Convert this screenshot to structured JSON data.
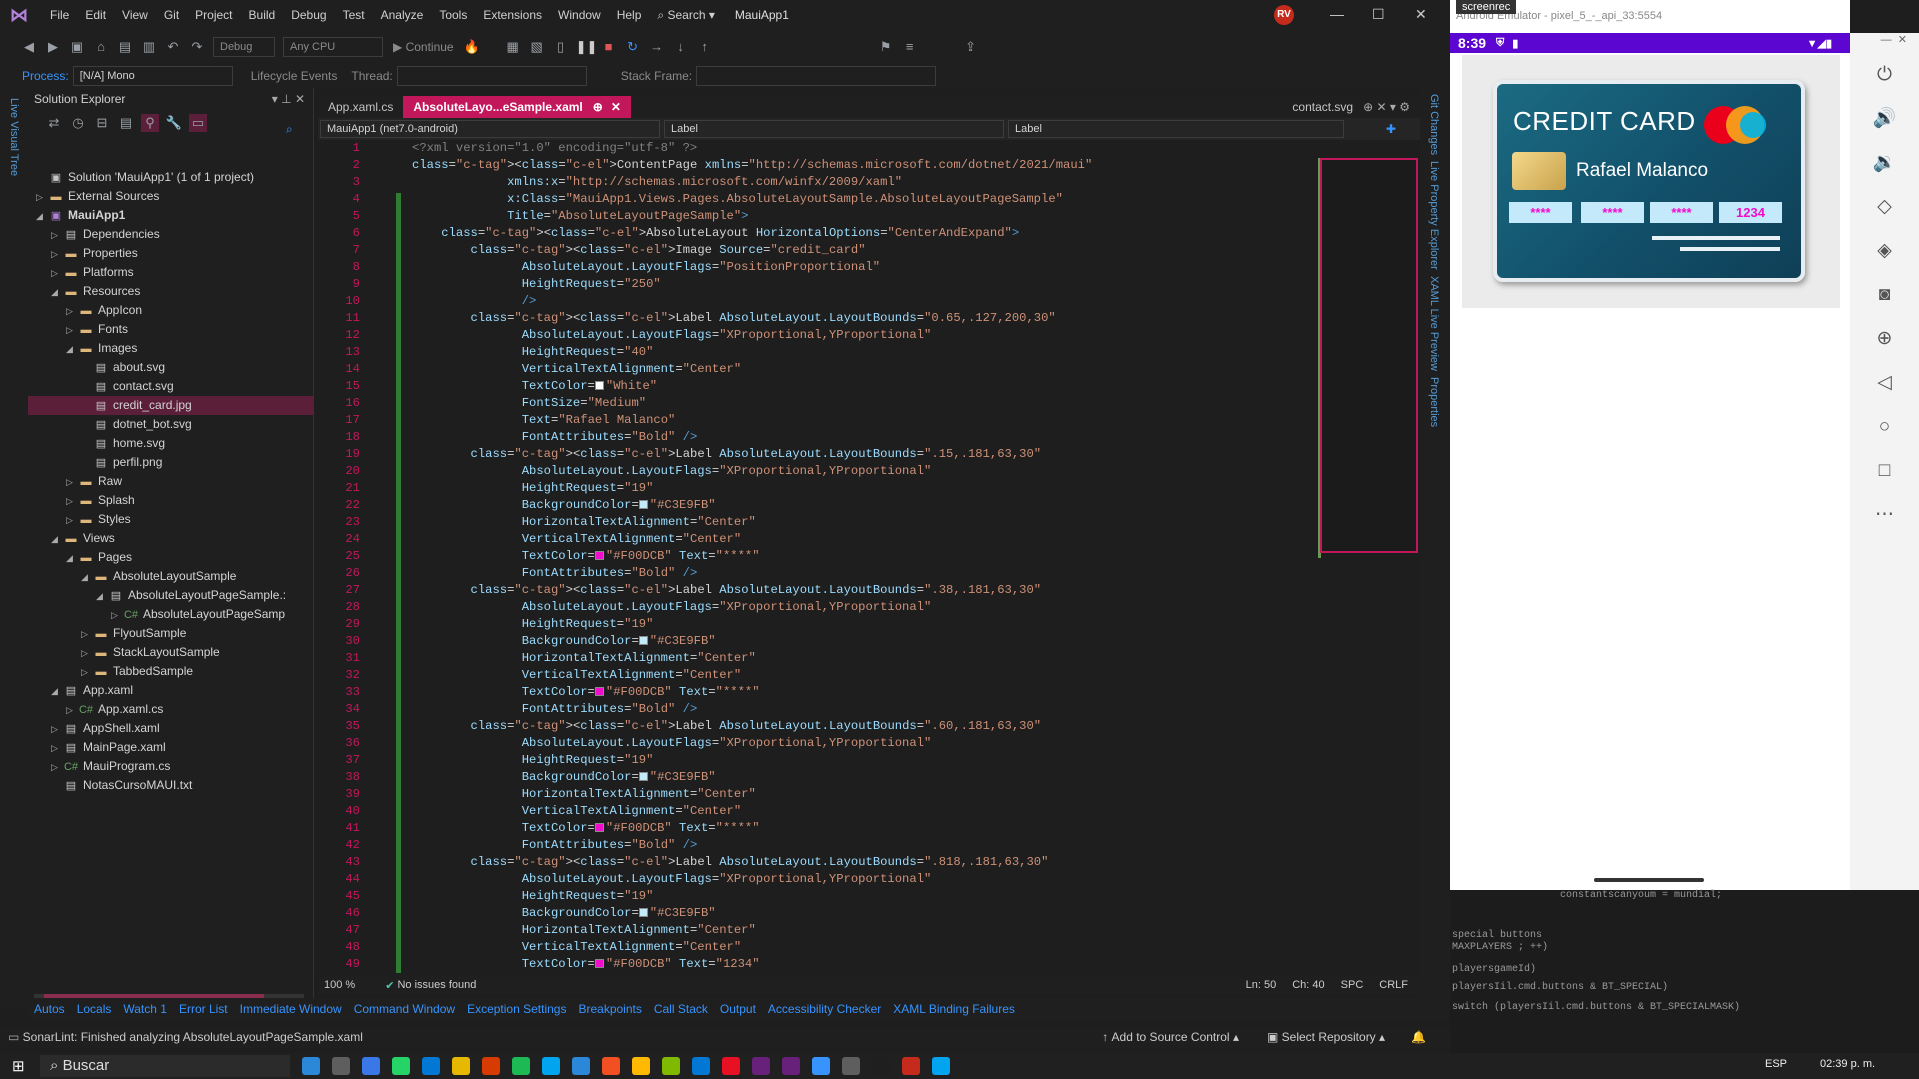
{
  "menubar": {
    "items": [
      "File",
      "Edit",
      "View",
      "Git",
      "Project",
      "Build",
      "Debug",
      "Test",
      "Analyze",
      "Tools",
      "Extensions",
      "Window",
      "Help"
    ],
    "search": "Search",
    "app_title": "MauiApp1",
    "avatar": "RV"
  },
  "toolbar": {
    "config": "Debug",
    "platform": "Any CPU",
    "continue": "Continue"
  },
  "procbar": {
    "process_label": "Process:",
    "process_value": "[N/A] Mono",
    "lifecycle": "Lifecycle Events",
    "thread_label": "Thread:",
    "stack_label": "Stack Frame:"
  },
  "leftrail": {
    "label": "Live Visual Tree"
  },
  "solution": {
    "title": "Solution Explorer",
    "nodes": [
      {
        "label": "Solution 'MauiApp1' (1 of 1 project)",
        "kind": "sol",
        "depth": 0,
        "arrow": ""
      },
      {
        "label": "External Sources",
        "kind": "folder",
        "depth": 0,
        "arrow": "▷"
      },
      {
        "label": "MauiApp1",
        "kind": "proj",
        "depth": 0,
        "arrow": "◢"
      },
      {
        "label": "Dependencies",
        "kind": "file",
        "depth": 1,
        "arrow": "▷"
      },
      {
        "label": "Properties",
        "kind": "folder",
        "depth": 1,
        "arrow": "▷"
      },
      {
        "label": "Platforms",
        "kind": "folder",
        "depth": 1,
        "arrow": "▷"
      },
      {
        "label": "Resources",
        "kind": "folder",
        "depth": 1,
        "arrow": "◢"
      },
      {
        "label": "AppIcon",
        "kind": "folder",
        "depth": 2,
        "arrow": "▷"
      },
      {
        "label": "Fonts",
        "kind": "folder",
        "depth": 2,
        "arrow": "▷"
      },
      {
        "label": "Images",
        "kind": "folder",
        "depth": 2,
        "arrow": "◢"
      },
      {
        "label": "about.svg",
        "kind": "file",
        "depth": 3,
        "arrow": ""
      },
      {
        "label": "contact.svg",
        "kind": "file",
        "depth": 3,
        "arrow": ""
      },
      {
        "label": "credit_card.jpg",
        "kind": "file",
        "depth": 3,
        "arrow": "",
        "selected": true
      },
      {
        "label": "dotnet_bot.svg",
        "kind": "file",
        "depth": 3,
        "arrow": ""
      },
      {
        "label": "home.svg",
        "kind": "file",
        "depth": 3,
        "arrow": ""
      },
      {
        "label": "perfil.png",
        "kind": "file",
        "depth": 3,
        "arrow": ""
      },
      {
        "label": "Raw",
        "kind": "folder",
        "depth": 2,
        "arrow": "▷"
      },
      {
        "label": "Splash",
        "kind": "folder",
        "depth": 2,
        "arrow": "▷"
      },
      {
        "label": "Styles",
        "kind": "folder",
        "depth": 2,
        "arrow": "▷"
      },
      {
        "label": "Views",
        "kind": "folder",
        "depth": 1,
        "arrow": "◢"
      },
      {
        "label": "Pages",
        "kind": "folder",
        "depth": 2,
        "arrow": "◢"
      },
      {
        "label": "AbsoluteLayoutSample",
        "kind": "folder",
        "depth": 3,
        "arrow": "◢"
      },
      {
        "label": "AbsoluteLayoutPageSample.:",
        "kind": "file",
        "depth": 4,
        "arrow": "◢"
      },
      {
        "label": "AbsoluteLayoutPageSamp",
        "kind": "cs",
        "depth": 5,
        "arrow": "▷"
      },
      {
        "label": "FlyoutSample",
        "kind": "folder",
        "depth": 3,
        "arrow": "▷"
      },
      {
        "label": "StackLayoutSample",
        "kind": "folder",
        "depth": 3,
        "arrow": "▷"
      },
      {
        "label": "TabbedSample",
        "kind": "folder",
        "depth": 3,
        "arrow": "▷"
      },
      {
        "label": "App.xaml",
        "kind": "file",
        "depth": 1,
        "arrow": "◢"
      },
      {
        "label": "App.xaml.cs",
        "kind": "cs",
        "depth": 2,
        "arrow": "▷"
      },
      {
        "label": "AppShell.xaml",
        "kind": "file",
        "depth": 1,
        "arrow": "▷"
      },
      {
        "label": "MainPage.xaml",
        "kind": "file",
        "depth": 1,
        "arrow": "▷"
      },
      {
        "label": "MauiProgram.cs",
        "kind": "cs",
        "depth": 1,
        "arrow": "▷"
      },
      {
        "label": "NotasCursoMAUI.txt",
        "kind": "file",
        "depth": 1,
        "arrow": ""
      }
    ]
  },
  "editor": {
    "tabs": [
      "App.xaml.cs",
      "AbsoluteLayo...eSample.xaml"
    ],
    "right_tab": "contact.svg",
    "nav_project": "MauiApp1 (net7.0-android)",
    "nav_mid": "Label",
    "nav_right": "Label",
    "zoom": "100 %",
    "issues": "No issues found",
    "ln": "Ln: 50",
    "ch": "Ch: 40",
    "spc": "SPC",
    "crlf": "CRLF",
    "lines": [
      "<?xml version=\"1.0\" encoding=\"utf-8\" ?>",
      "<ContentPage xmlns=\"http://schemas.microsoft.com/dotnet/2021/maui\"",
      "             xmlns:x=\"http://schemas.microsoft.com/winfx/2009/xaml\"",
      "             x:Class=\"MauiApp1.Views.Pages.AbsoluteLayoutSample.AbsoluteLayoutPageSample\"",
      "             Title=\"AbsoluteLayoutPageSample\">",
      "    <AbsoluteLayout HorizontalOptions=\"CenterAndExpand\">",
      "        <Image Source=\"credit_card\"",
      "               AbsoluteLayout.LayoutFlags=\"PositionProportional\"",
      "               HeightRequest=\"250\"",
      "               />",
      "        <Label AbsoluteLayout.LayoutBounds=\"0.65,.127,200,30\"",
      "               AbsoluteLayout.LayoutFlags=\"XProportional,YProportional\"",
      "               HeightRequest=\"40\"",
      "               VerticalTextAlignment=\"Center\"",
      "               TextColor=\"White\"",
      "               FontSize=\"Medium\"",
      "               Text=\"Rafael Malanco\"",
      "               FontAttributes=\"Bold\" />",
      "        <Label AbsoluteLayout.LayoutBounds=\".15,.181,63,30\"",
      "               AbsoluteLayout.LayoutFlags=\"XProportional,YProportional\"",
      "               HeightRequest=\"19\"",
      "               BackgroundColor=\"#C3E9FB\"",
      "               HorizontalTextAlignment=\"Center\"",
      "               VerticalTextAlignment=\"Center\"",
      "               TextColor=\"#F00DCB\" Text=\"****\"",
      "               FontAttributes=\"Bold\" />",
      "        <Label AbsoluteLayout.LayoutBounds=\".38,.181,63,30\"",
      "               AbsoluteLayout.LayoutFlags=\"XProportional,YProportional\"",
      "               HeightRequest=\"19\"",
      "               BackgroundColor=\"#C3E9FB\"",
      "               HorizontalTextAlignment=\"Center\"",
      "               VerticalTextAlignment=\"Center\"",
      "               TextColor=\"#F00DCB\" Text=\"****\"",
      "               FontAttributes=\"Bold\" />",
      "        <Label AbsoluteLayout.LayoutBounds=\".60,.181,63,30\"",
      "               AbsoluteLayout.LayoutFlags=\"XProportional,YProportional\"",
      "               HeightRequest=\"19\"",
      "               BackgroundColor=\"#C3E9FB\"",
      "               HorizontalTextAlignment=\"Center\"",
      "               VerticalTextAlignment=\"Center\"",
      "               TextColor=\"#F00DCB\" Text=\"****\"",
      "               FontAttributes=\"Bold\" />",
      "        <Label AbsoluteLayout.LayoutBounds=\".818,.181,63,30\"",
      "               AbsoluteLayout.LayoutFlags=\"XProportional,YProportional\"",
      "               HeightRequest=\"19\"",
      "               BackgroundColor=\"#C3E9FB\"",
      "               HorizontalTextAlignment=\"Center\"",
      "               VerticalTextAlignment=\"Center\"",
      "               TextColor=\"#F00DCB\" Text=\"1234\""
    ]
  },
  "bottomtabs": [
    "Autos",
    "Locals",
    "Watch 1",
    "Error List",
    "Immediate Window",
    "Command Window",
    "Exception Settings",
    "Breakpoints",
    "Call Stack",
    "Output",
    "Accessibility Checker",
    "XAML Binding Failures"
  ],
  "statusbar": {
    "message": "SonarLint: Finished analyzing AbsoluteLayoutPageSample.xaml",
    "source_control": "Add to Source Control",
    "repository": "Select Repository"
  },
  "rightrail": {
    "items": [
      "Git Changes",
      "Live Property Explorer",
      "XAML Live Preview",
      "Properties"
    ]
  },
  "emulator": {
    "recorder": "screenrec",
    "title": "Android Emulator - pixel_5_-_api_33:5554",
    "time": "8:39",
    "card": {
      "title": "CREDIT CARD",
      "name": "Rafael Malanco",
      "labels": [
        "****",
        "****",
        "****",
        "1234"
      ],
      "label_bg": "#C3E9FB",
      "label_fg": "#F00DCB"
    },
    "behind_text": [
      "constantscanyoum = mundial;",
      "special buttons",
      "MAXPLAYERS ; ++)",
      "playersgameId)",
      "playersIil.cmd.buttons & BT_SPECIAL)",
      "switch (playersIil.cmd.buttons & BT_SPECIALMASK)"
    ]
  },
  "taskbar": {
    "search": "Buscar",
    "lang": "ESP",
    "clock": "02:39 p. m."
  }
}
